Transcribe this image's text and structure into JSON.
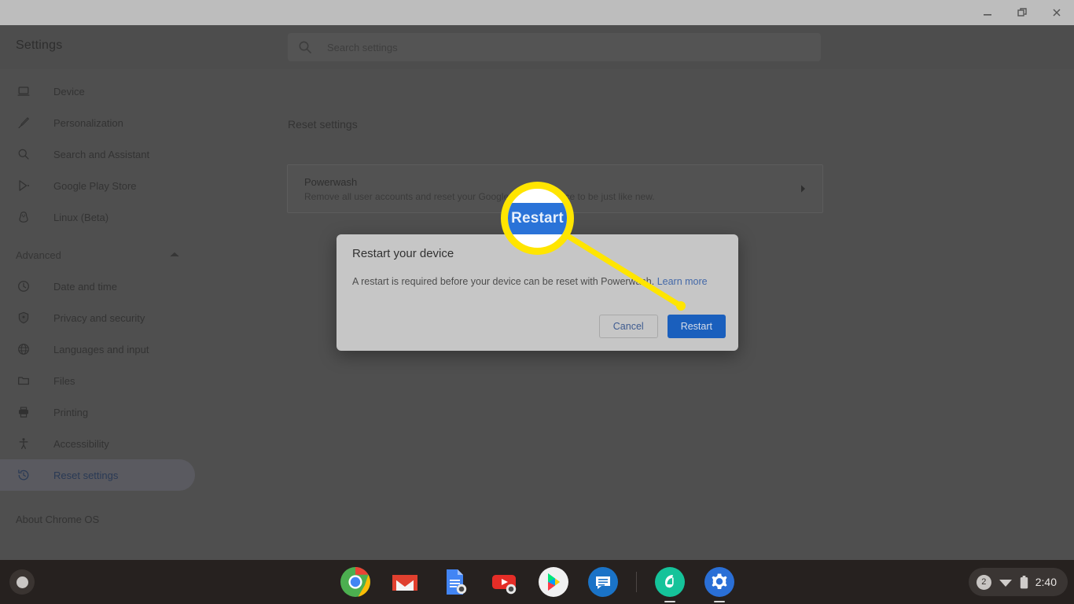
{
  "window": {
    "controls": [
      {
        "name": "minimize",
        "label": "Minimize"
      },
      {
        "name": "maximize",
        "label": "Maximize"
      },
      {
        "name": "close",
        "label": "Close"
      }
    ]
  },
  "settings": {
    "title": "Settings",
    "search": {
      "placeholder": "Search settings",
      "value": "",
      "icon": "search-icon"
    },
    "sidebar": {
      "items": [
        {
          "label": "Device",
          "icon": "laptop-icon",
          "selected": false
        },
        {
          "label": "Personalization",
          "icon": "brush-icon",
          "selected": false
        },
        {
          "label": "Search and Assistant",
          "icon": "search-icon",
          "selected": false
        },
        {
          "label": "Google Play Store",
          "icon": "play-store-icon",
          "selected": false
        },
        {
          "label": "Linux (Beta)",
          "icon": "linux-penguin-icon",
          "selected": false
        }
      ],
      "advanced": {
        "label": "Advanced",
        "expanded": true,
        "icon": "chevron-up-icon"
      },
      "advanced_items": [
        {
          "label": "Date and time",
          "icon": "clock-icon",
          "selected": false
        },
        {
          "label": "Privacy and security",
          "icon": "shield-icon",
          "selected": false
        },
        {
          "label": "Languages and input",
          "icon": "globe-icon",
          "selected": false
        },
        {
          "label": "Files",
          "icon": "folder-icon",
          "selected": false
        },
        {
          "label": "Printing",
          "icon": "printer-icon",
          "selected": false
        },
        {
          "label": "Accessibility",
          "icon": "accessibility-icon",
          "selected": false
        },
        {
          "label": "Reset settings",
          "icon": "history-restore-icon",
          "selected": true
        }
      ],
      "about": {
        "label": "About Chrome OS"
      }
    },
    "main": {
      "section_title": "Reset settings",
      "powerwash": {
        "title": "Powerwash",
        "description": "Remove all user accounts and reset your Google Chrome device to be just like new.",
        "chevron": "chevron-right-icon"
      }
    }
  },
  "dialog": {
    "title": "Restart your device",
    "body": "A restart is required before your device can be reset with Powerwash.",
    "link_label": "Learn more",
    "cancel_label": "Cancel",
    "restart_label": "Restart"
  },
  "callout": {
    "magnified_label": "Restart",
    "highlight_color": "#ffe500",
    "button_color": "#2a73d8"
  },
  "shelf": {
    "launcher": {
      "name": "launcher-button",
      "icon": "launcher-circle-icon"
    },
    "apps": [
      {
        "name": "chrome",
        "label": "Google Chrome",
        "running": false
      },
      {
        "name": "gmail",
        "label": "Gmail",
        "running": false
      },
      {
        "name": "docs",
        "label": "Google Docs",
        "running": false
      },
      {
        "name": "youtube",
        "label": "YouTube",
        "running": false
      },
      {
        "name": "play-store",
        "label": "Google Play Store",
        "running": false
      },
      {
        "name": "messages",
        "label": "Messages",
        "running": false
      },
      {
        "name": "grammarly",
        "label": "Grammarly",
        "running": true
      },
      {
        "name": "settings",
        "label": "Settings",
        "running": true
      }
    ],
    "tray": {
      "notification_count": "2",
      "wifi_icon": "wifi-icon",
      "battery_icon": "battery-icon",
      "time": "2:40"
    }
  }
}
